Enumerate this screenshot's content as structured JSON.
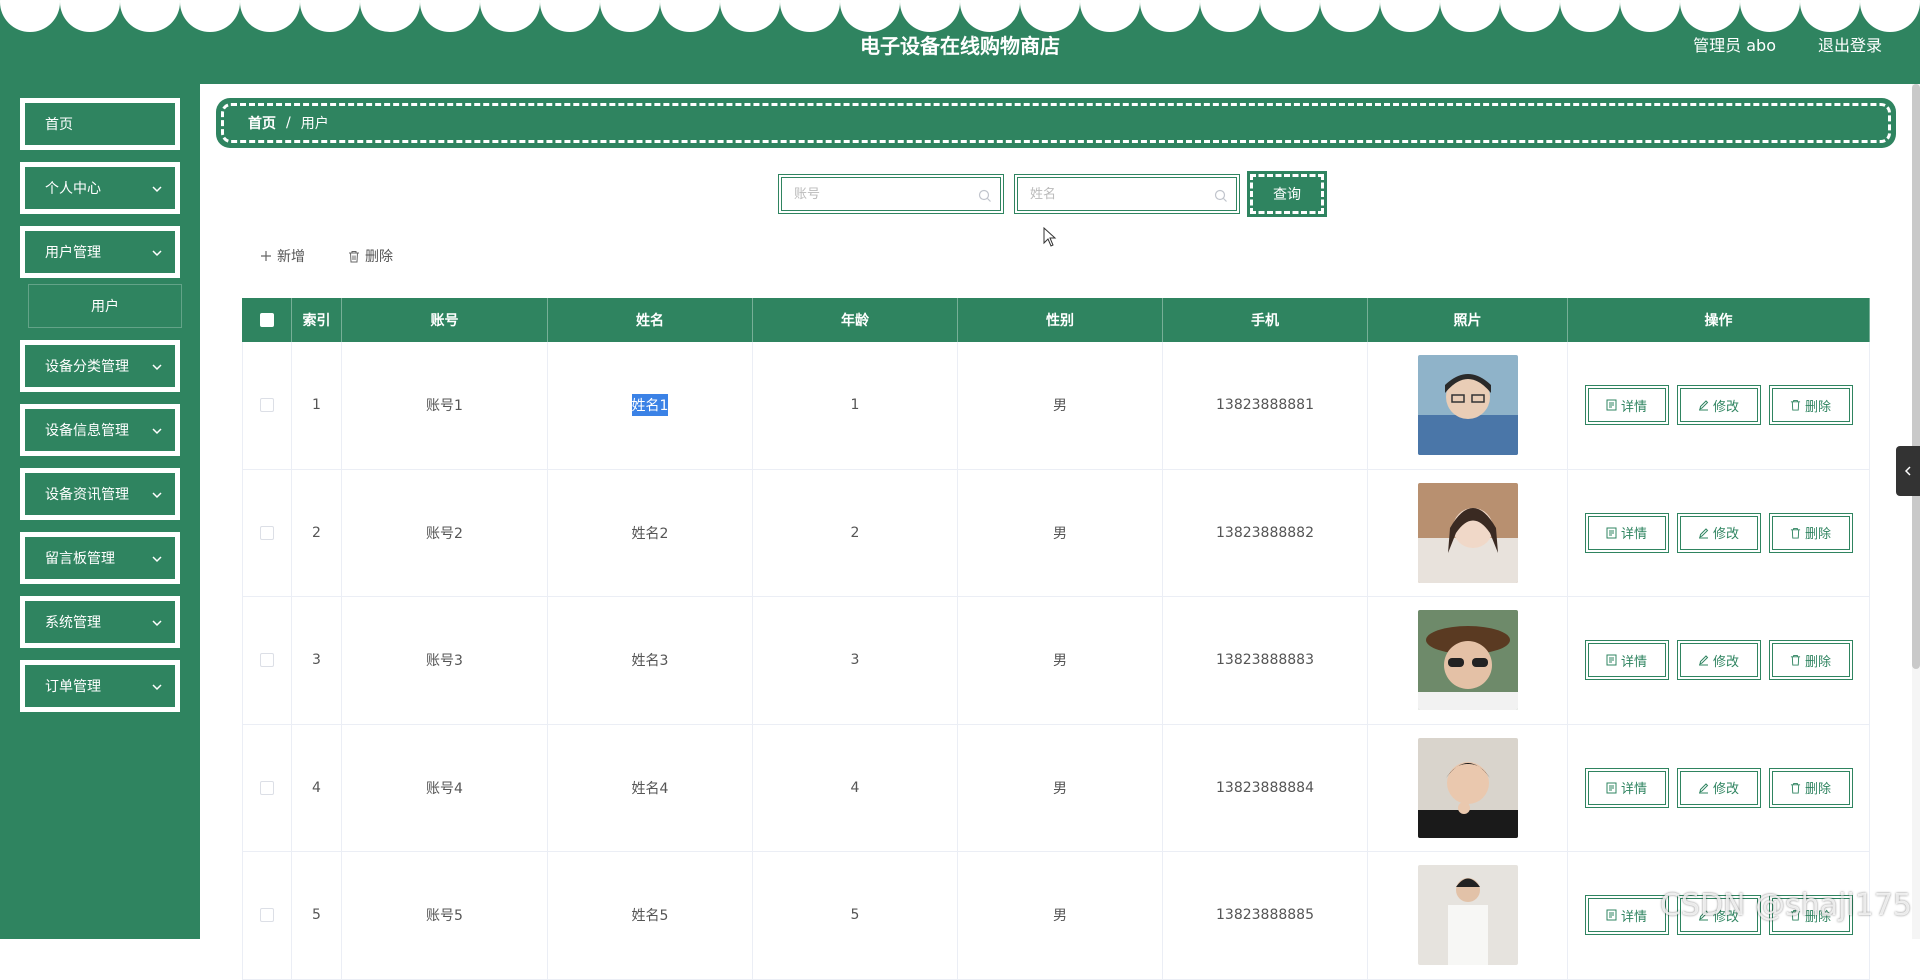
{
  "header": {
    "title": "电子设备在线购物商店",
    "user": "管理员 abo",
    "logout": "退出登录",
    "color": "#2f8460"
  },
  "sidebar": {
    "items": [
      {
        "label": "首页"
      },
      {
        "label": "个人中心"
      },
      {
        "label": "用户管理"
      },
      {
        "label": "设备分类管理"
      },
      {
        "label": "设备信息管理"
      },
      {
        "label": "设备资讯管理"
      },
      {
        "label": "留言板管理"
      },
      {
        "label": "系统管理"
      },
      {
        "label": "订单管理"
      }
    ],
    "submenu": {
      "label": "用户"
    }
  },
  "breadcrumb": {
    "home": "首页",
    "separator": "/",
    "current": "用户"
  },
  "search": {
    "account_placeholder": "账号",
    "name_placeholder": "姓名",
    "query_label": "查询"
  },
  "actions": {
    "add_label": "新增",
    "delete_label": "删除"
  },
  "table": {
    "headers": [
      "索引",
      "账号",
      "姓名",
      "年龄",
      "性别",
      "手机",
      "照片",
      "操作"
    ],
    "rows": [
      {
        "index": "1",
        "account": "账号1",
        "name": "姓名1",
        "age": "1",
        "gender": "男",
        "phone": "13823888881"
      },
      {
        "index": "2",
        "account": "账号2",
        "name": "姓名2",
        "age": "2",
        "gender": "男",
        "phone": "13823888882"
      },
      {
        "index": "3",
        "account": "账号3",
        "name": "姓名3",
        "age": "3",
        "gender": "男",
        "phone": "13823888883"
      },
      {
        "index": "4",
        "account": "账号4",
        "name": "姓名4",
        "age": "4",
        "gender": "男",
        "phone": "13823888884"
      },
      {
        "index": "5",
        "account": "账号5",
        "name": "姓名5",
        "age": "5",
        "gender": "男",
        "phone": "13823888885"
      }
    ],
    "row_buttons": {
      "detail": "详情",
      "edit": "修改",
      "delete": "删除"
    }
  },
  "watermark": "CSDN @shaji175"
}
